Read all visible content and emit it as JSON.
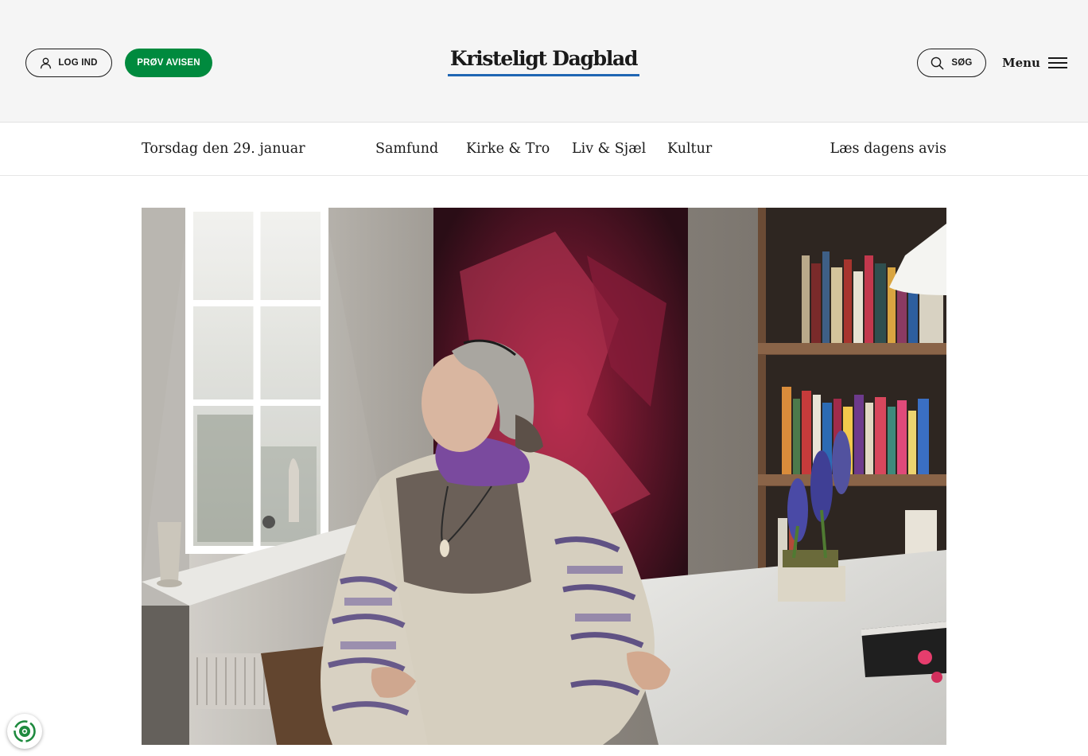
{
  "header": {
    "login_label": "LOG IND",
    "try_label": "PRØV AVISEN",
    "logo_text": "Kristeligt Dagblad",
    "search_label": "SØG",
    "menu_label": "Menu"
  },
  "nav": {
    "date": "Torsdag den 29. januar",
    "links": [
      "Samfund",
      "Kirke & Tro",
      "Liv & Sjæl",
      "Kultur"
    ],
    "read_today": "Læs dagens avis"
  },
  "colors": {
    "brand_green": "#008a3e",
    "logo_underline": "#1f66b3",
    "header_bg": "#f5f5f5"
  },
  "icons": {
    "login": "user-icon",
    "search": "search-icon",
    "menu": "hamburger-icon",
    "cookie": "cookie-consent-icon"
  }
}
